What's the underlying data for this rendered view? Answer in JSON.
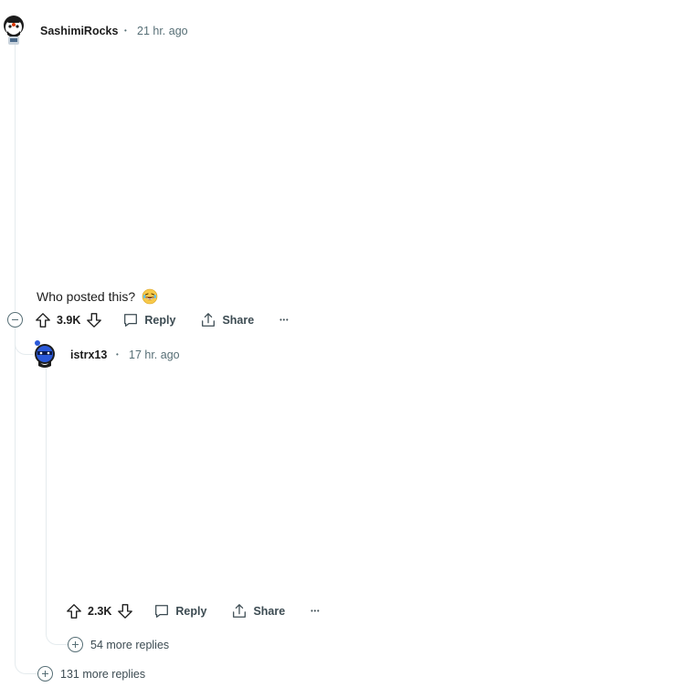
{
  "comments": [
    {
      "username": "SashimiRocks",
      "separator": "•",
      "time": "21 hr. ago",
      "body": "Who posted this?",
      "emoji": "😂",
      "score": "3.9K",
      "reply_label": "Reply",
      "share_label": "Share",
      "more_label": "•••"
    },
    {
      "username": "istrx13",
      "separator": "•",
      "time": "17 hr. ago",
      "score": "2.3K",
      "reply_label": "Reply",
      "share_label": "Share",
      "more_label": "•••",
      "more_replies": "54 more replies"
    }
  ],
  "thread": {
    "more_replies": "131 more replies"
  },
  "colors": {
    "thread_line": "#e5ebee",
    "meta_text": "#576f76",
    "action_text": "#3c4b52"
  }
}
